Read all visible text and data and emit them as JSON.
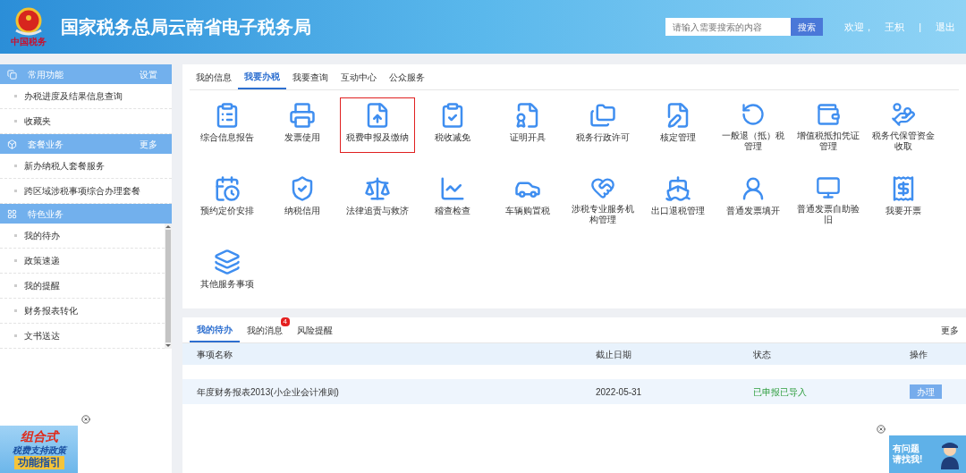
{
  "header": {
    "title": "国家税务总局云南省电子税务局",
    "emblem_caption": "中国税务",
    "search": {
      "placeholder": "请输入需要搜索的内容",
      "button": "搜索"
    },
    "welcome": "欢迎，",
    "user": "王枳",
    "separator": "|",
    "logout": "退出"
  },
  "sidebar": {
    "sections": [
      {
        "title": "常用功能",
        "action": "设置",
        "items": [
          "办税进度及结果信息查询",
          "收藏夹"
        ]
      },
      {
        "title": "套餐业务",
        "action": "更多",
        "items": [
          "新办纳税人套餐服务",
          "跨区域涉税事项综合办理套餐"
        ]
      },
      {
        "title": "特色业务",
        "items": [
          "我的待办",
          "政策速递",
          "我的提醒",
          "财务报表转化",
          "文书送达"
        ]
      }
    ],
    "banner": {
      "line_1": "组合式",
      "line_2": "税费支持政策",
      "line_3": "功能指引"
    }
  },
  "main": {
    "tabs": [
      {
        "label": "我的信息",
        "selected": false
      },
      {
        "label": "我要办税",
        "selected": true
      },
      {
        "label": "我要查询",
        "selected": false
      },
      {
        "label": "互动中心",
        "selected": false
      },
      {
        "label": "公众服务",
        "selected": false
      }
    ],
    "services": [
      {
        "label": "综合信息报告",
        "selected": false
      },
      {
        "label": "发票使用",
        "selected": false
      },
      {
        "label": "税费申报及缴纳",
        "selected": true
      },
      {
        "label": "税收减免",
        "selected": false
      },
      {
        "label": "证明开具",
        "selected": false
      },
      {
        "label": "税务行政许可",
        "selected": false
      },
      {
        "label": "核定管理",
        "selected": false
      },
      {
        "label": "一般退（抵）税管理",
        "selected": false
      },
      {
        "label": "增值税抵扣凭证管理",
        "selected": false
      },
      {
        "label": "税务代保管资金收取",
        "selected": false
      },
      {
        "label": "预约定价安排",
        "selected": false
      },
      {
        "label": "纳税信用",
        "selected": false
      },
      {
        "label": "法律追责与救济",
        "selected": false
      },
      {
        "label": "稽查检查",
        "selected": false
      },
      {
        "label": "车辆购置税",
        "selected": false
      },
      {
        "label": "涉税专业服务机构管理",
        "selected": false
      },
      {
        "label": "出口退税管理",
        "selected": false
      },
      {
        "label": "普通发票填开",
        "selected": false
      },
      {
        "label": "普通发票自助验旧",
        "selected": false
      },
      {
        "label": "我要开票",
        "selected": false
      },
      {
        "label": "其他服务事项",
        "selected": false
      }
    ]
  },
  "todo": {
    "tabs": [
      {
        "label": "我的待办",
        "selected": true
      },
      {
        "label": "我的消息",
        "selected": false,
        "badge": "4"
      },
      {
        "label": "风险提醒",
        "selected": false
      }
    ],
    "more": "更多",
    "table": {
      "columns": [
        "事项名称",
        "截止日期",
        "状态",
        "操作"
      ],
      "rows": [
        {
          "name": "年度财务报表2013(小企业会计准则)",
          "deadline": "2022-05-31",
          "status": "已申报已导入",
          "action": "办理"
        }
      ]
    }
  },
  "helper": {
    "line_1": "有问题",
    "line_2": "请找我!"
  }
}
